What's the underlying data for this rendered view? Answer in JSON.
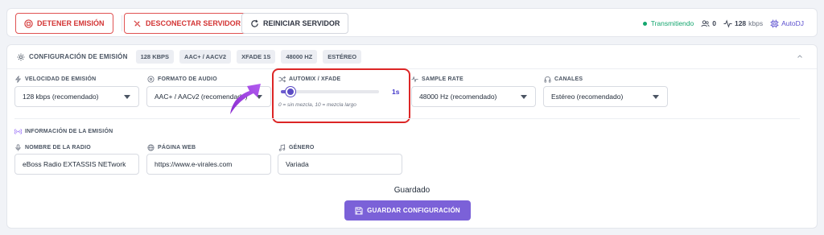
{
  "toolbar": {
    "stop_label": "DETENER EMISIÓN",
    "disconnect_label": "DESCONECTAR SERVIDOR",
    "restart_label": "REINICIAR SERVIDOR",
    "status_text": "Transmitiendo",
    "listeners": "0",
    "bitrate": "128",
    "bitrate_unit": "kbps",
    "autodj_label": "AutoDJ"
  },
  "config": {
    "title": "CONFIGURACIÓN DE EMISIÓN",
    "pills": [
      "128 KBPS",
      "AAC+ / AACV2",
      "XFADE 1S",
      "48000 HZ",
      "ESTÉREO"
    ],
    "bitrate_label": "VELOCIDAD DE EMISIÓN",
    "bitrate_value": "128 kbps (recomendado)",
    "format_label": "FORMATO DE AUDIO",
    "format_value": "AAC+ / AACv2 (recomendado)",
    "automix_label": "AUTOMIX / XFADE",
    "automix_value_text": "1s",
    "automix_value": 1,
    "automix_min": 0,
    "automix_max": 10,
    "automix_hint": "0 = sin mezcla, 10 = mezcla largo",
    "samplerate_label": "SAMPLE RATE",
    "samplerate_value": "48000 Hz (recomendado)",
    "channels_label": "CANALES",
    "channels_value": "Estéreo (recomendado)"
  },
  "info": {
    "section_title": "INFORMACIÓN DE LA EMISIÓN",
    "radio_name_label": "NOMBRE DE LA RADIO",
    "radio_name_value": "eBoss Radio EXTASSIS NETwork",
    "website_label": "PÁGINA WEB",
    "website_value": "https://www.e-virales.com",
    "genre_label": "GÉNERO",
    "genre_value": "Variada"
  },
  "footer": {
    "saved_text": "Guardado",
    "save_label": "GUARDAR CONFIGURACIÓN"
  },
  "colors": {
    "danger": "#d33434",
    "success": "#14a66e",
    "accent": "#7b61d8",
    "highlight": "#dc2626"
  }
}
